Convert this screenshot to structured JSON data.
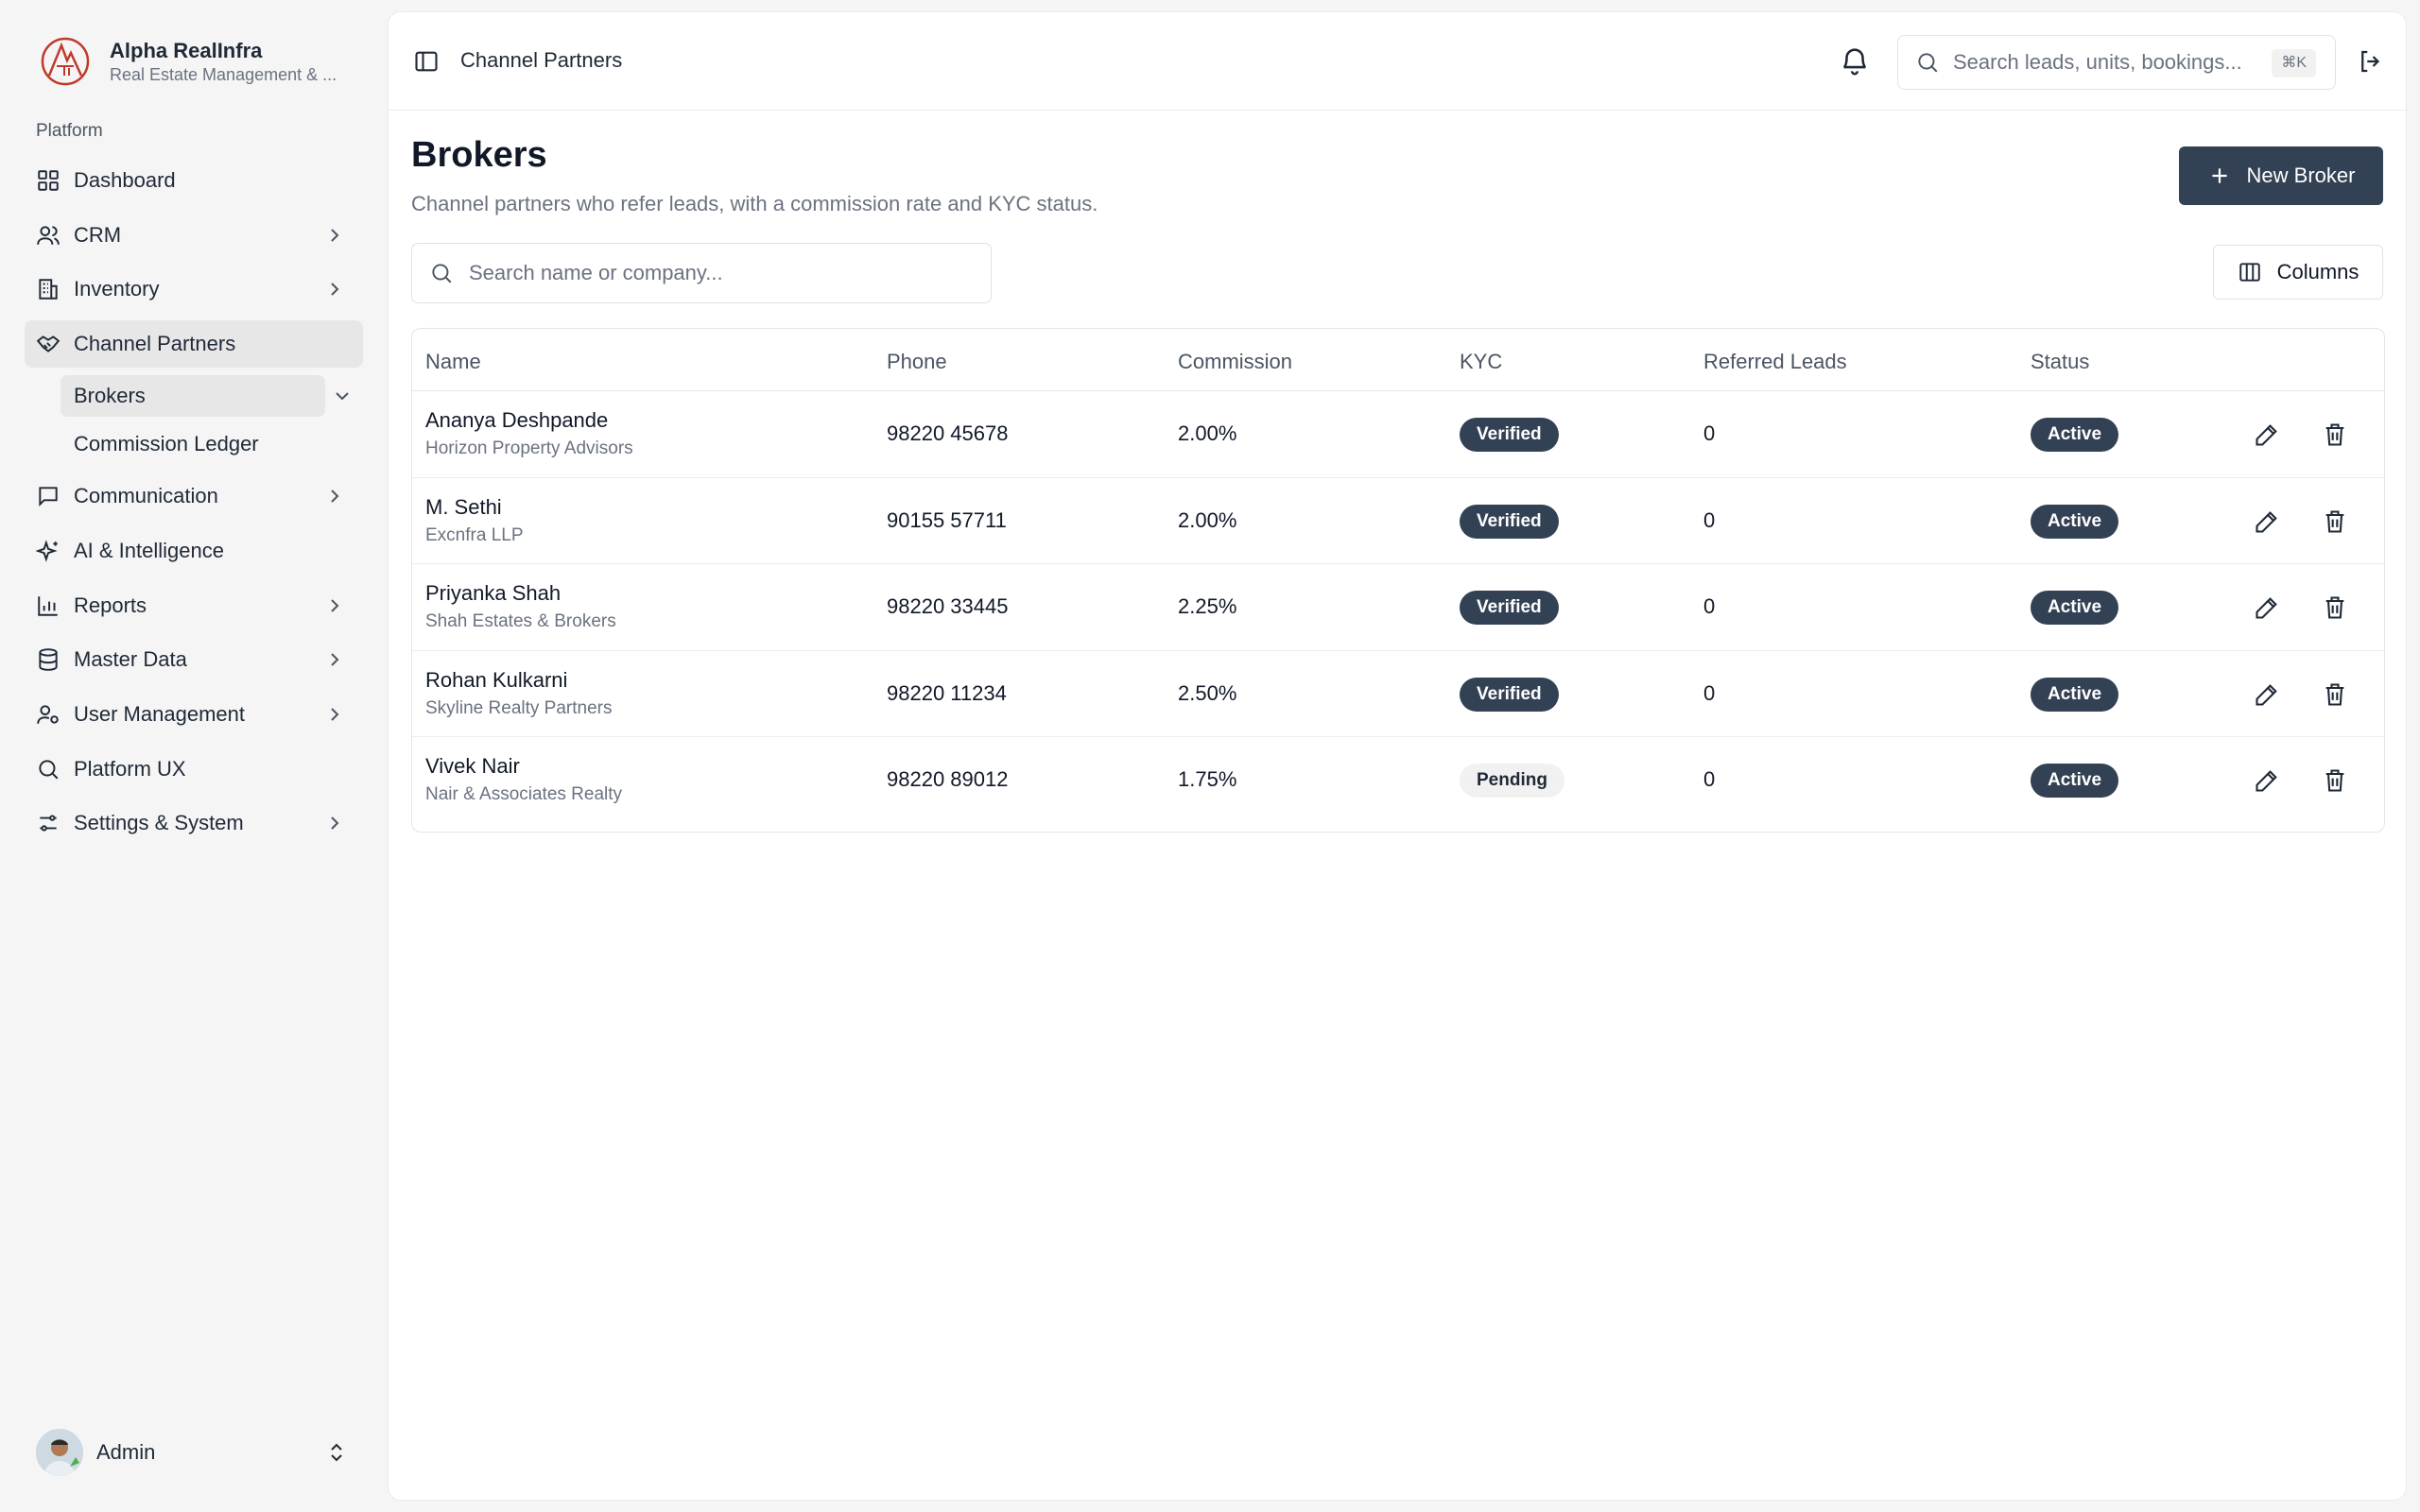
{
  "brand": {
    "name": "Alpha RealInfra",
    "subtitle": "Real Estate Management & ..."
  },
  "sidebar": {
    "section_label": "Platform",
    "items": [
      {
        "label": "Dashboard",
        "icon": "dashboard-icon"
      },
      {
        "label": "CRM",
        "icon": "users-icon"
      },
      {
        "label": "Inventory",
        "icon": "building-icon"
      },
      {
        "label": "Channel Partners",
        "icon": "handshake-icon"
      },
      {
        "label": "Communication",
        "icon": "message-icon"
      },
      {
        "label": "AI & Intelligence",
        "icon": "sparkles-icon"
      },
      {
        "label": "Reports",
        "icon": "bar-chart-icon"
      },
      {
        "label": "Master Data",
        "icon": "database-icon"
      },
      {
        "label": "User Management",
        "icon": "user-cog-icon"
      },
      {
        "label": "Platform UX",
        "icon": "search-icon"
      },
      {
        "label": "Settings & System",
        "icon": "sliders-icon"
      }
    ],
    "sub_items": [
      {
        "label": "Brokers"
      },
      {
        "label": "Commission Ledger"
      }
    ]
  },
  "user": {
    "name": "Admin"
  },
  "topbar": {
    "breadcrumb": "Channel Partners",
    "search_placeholder": "Search leads, units, bookings...",
    "shortcut": "⌘K"
  },
  "page": {
    "title": "Brokers",
    "subtitle": "Channel partners who refer leads, with a commission rate and KYC status.",
    "new_button": "New Broker",
    "search_placeholder": "Search name or company...",
    "columns_button": "Columns"
  },
  "table": {
    "headers": [
      "Name",
      "Phone",
      "Commission",
      "KYC",
      "Referred Leads",
      "Status"
    ],
    "rows": [
      {
        "name": "Ananya Deshpande",
        "company": "Horizon Property Advisors",
        "phone": "98220 45678",
        "commission": "2.00%",
        "kyc": "Verified",
        "referred": "0",
        "status": "Active"
      },
      {
        "name": "M. Sethi",
        "company": "Excnfra LLP",
        "phone": "90155 57711",
        "commission": "2.00%",
        "kyc": "Verified",
        "referred": "0",
        "status": "Active"
      },
      {
        "name": "Priyanka Shah",
        "company": "Shah Estates & Brokers",
        "phone": "98220 33445",
        "commission": "2.25%",
        "kyc": "Verified",
        "referred": "0",
        "status": "Active"
      },
      {
        "name": "Rohan Kulkarni",
        "company": "Skyline Realty Partners",
        "phone": "98220 11234",
        "commission": "2.50%",
        "kyc": "Verified",
        "referred": "0",
        "status": "Active"
      },
      {
        "name": "Vivek Nair",
        "company": "Nair & Associates Realty",
        "phone": "98220 89012",
        "commission": "1.75%",
        "kyc": "Pending",
        "referred": "0",
        "status": "Active"
      }
    ]
  },
  "colors": {
    "primary": "#334155",
    "brand_red": "#c0392b",
    "muted_text": "#6b7280"
  }
}
